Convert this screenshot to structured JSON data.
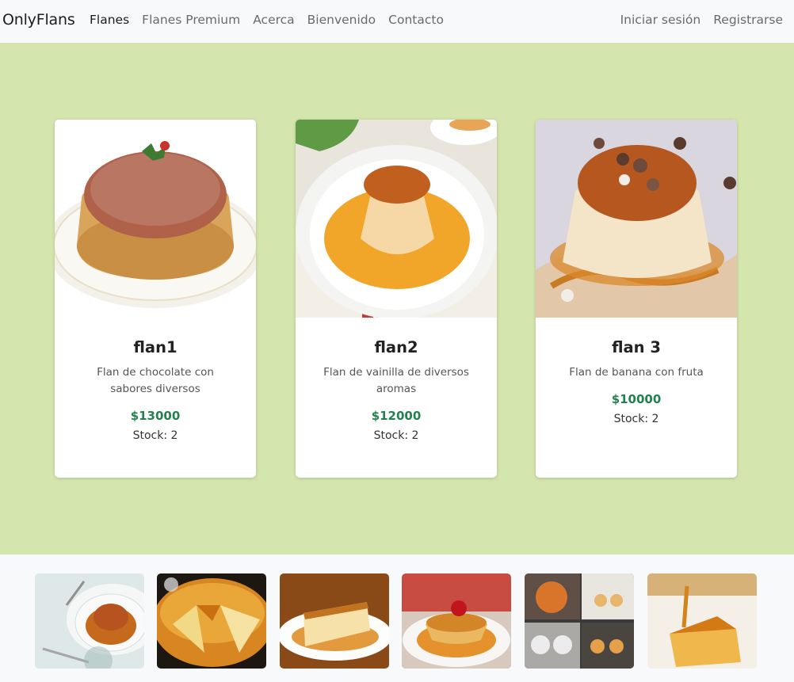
{
  "navbar": {
    "brand": "OnlyFlans",
    "links": [
      "Flanes",
      "Flanes Premium",
      "Acerca",
      "Bienvenido",
      "Contacto"
    ],
    "auth": [
      "Iniciar sesión",
      "Registrarse"
    ]
  },
  "cards": [
    {
      "title": "flan1",
      "description": "Flan de chocolate con sabores diversos",
      "price": "$13000",
      "stock": "Stock: 2",
      "image": "flan-chocolate-photo"
    },
    {
      "title": "flan2",
      "description": "Flan de vainilla de diversos aromas",
      "price": "$12000",
      "stock": "Stock: 2",
      "image": "flan-vainilla-photo"
    },
    {
      "title": "flan 3",
      "description": "Flan de banana con fruta",
      "price": "$10000",
      "stock": "Stock: 2",
      "image": "flan-banana-photo"
    }
  ],
  "gallery": [
    "flan-plate-photo",
    "flan-cake-photo",
    "flan-slice-photo",
    "flan-cherry-photo",
    "flan-kitchen-photo",
    "flan-caramel-slice-photo"
  ],
  "colors": {
    "navbar_bg": "#f8f9fa",
    "main_bg": "#d4e6ae",
    "price": "#22814f",
    "caramel": "#b8541a"
  }
}
